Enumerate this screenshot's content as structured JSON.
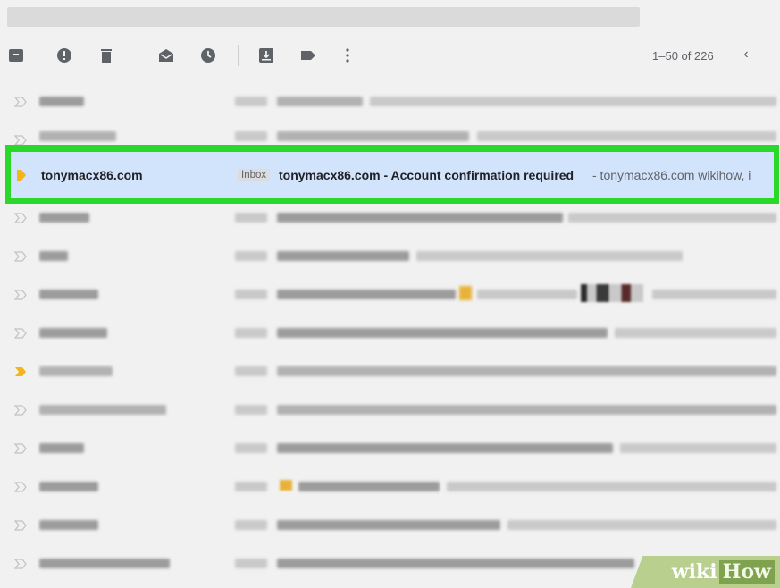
{
  "toolbar": {
    "icons": [
      "archive-icon",
      "report-spam-icon",
      "delete-icon",
      "mark-unread-icon",
      "snooze-icon",
      "move-to-icon",
      "label-icon",
      "more-icon"
    ],
    "pagination": "1–50 of 226",
    "prev_glyph": "‹"
  },
  "highlighted_email": {
    "sender": "tonymacx86.com",
    "label": "Inbox",
    "subject": "tonymacx86.com - Account confirmation required",
    "snippet": " - tonymacx86.com wikihow, i"
  },
  "watermark": {
    "wiki": "wiki",
    "how": "How"
  },
  "colors": {
    "highlight_border": "#29d829",
    "selected_row": "#d2e3fc",
    "important_marker": "#f2b51e",
    "background": "#f1f1f1"
  }
}
